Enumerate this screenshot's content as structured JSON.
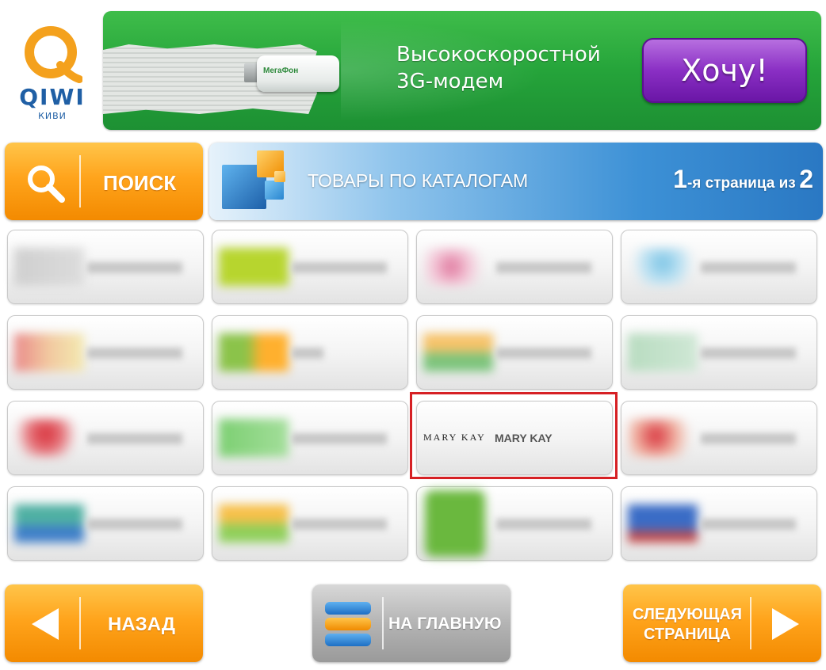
{
  "logo": {
    "title": "QIWI",
    "subtitle": "КИВИ"
  },
  "banner": {
    "modem_brand": "МегаФон",
    "headline_line1": "Высокоскоростной",
    "headline_line2": "3G-модем",
    "cta_label": "Хочу!"
  },
  "search": {
    "label": "ПОИСК",
    "icon": "search-icon"
  },
  "catalog": {
    "title": "ТОВАРЫ ПО КАТАЛОГАМ",
    "page_current": "1",
    "page_suffix": "-я страница из",
    "page_total": "2"
  },
  "tiles": {
    "active": {
      "logo": "MARY KAY",
      "name": "MARY KAY"
    }
  },
  "nav": {
    "back_label": "НАЗАД",
    "home_label": "НА ГЛАВНУЮ",
    "next_label_line1": "СЛЕДУЮЩАЯ",
    "next_label_line2": "СТРАНИЦА"
  },
  "colors": {
    "accent_orange": "#ffa41c",
    "banner_green": "#25a43a",
    "cta_purple": "#8a2fc4",
    "header_blue": "#2a78c3",
    "highlight_red": "#d62024"
  }
}
